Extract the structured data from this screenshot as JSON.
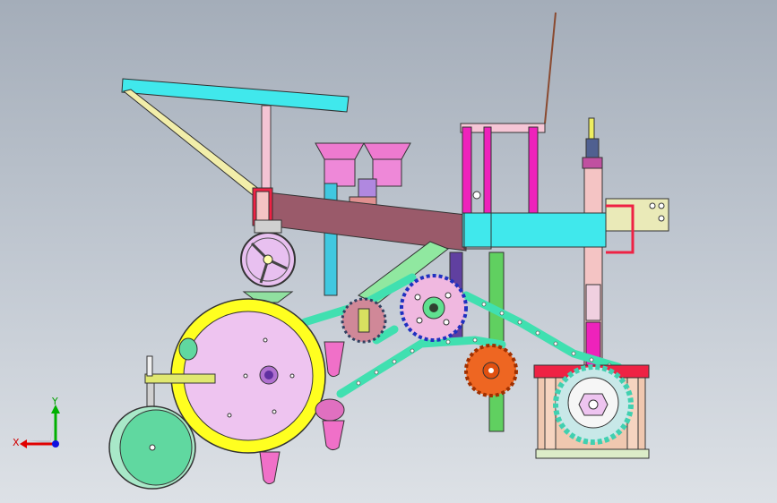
{
  "viewport": {
    "background_top": "#a4adb9",
    "background_bottom": "#dde1e6"
  },
  "triad": {
    "x_label": "X",
    "y_label": "Y",
    "x_color": "#e00000",
    "y_color": "#00b000",
    "z_color": "#1010e0"
  },
  "colors": {
    "handle_bar": "#40e8ec",
    "brace": "#f2eeaa",
    "main_beam": "#9a5a6a",
    "cross_beam": "#40e8ec",
    "seed_hopper": "#ee7ad0",
    "magenta_frame": "#ee22bb",
    "disc_rim": "#ffff20",
    "disc_face": "#eec4f0",
    "wheel": "#60d8a0",
    "chain": "#40e0b0",
    "sprocket_orange": "#ee6622",
    "sprocket_pink": "#f0b8e0",
    "shoe": "#f070c8",
    "gearbox": "#f0c8b0",
    "post": "#f4c4c4",
    "red_plate": "#ee2244"
  },
  "icons": [
    "axis-triad-icon",
    "handwheel-icon",
    "sprocket-icon",
    "seed-disc-icon",
    "depth-wheel-icon"
  ]
}
